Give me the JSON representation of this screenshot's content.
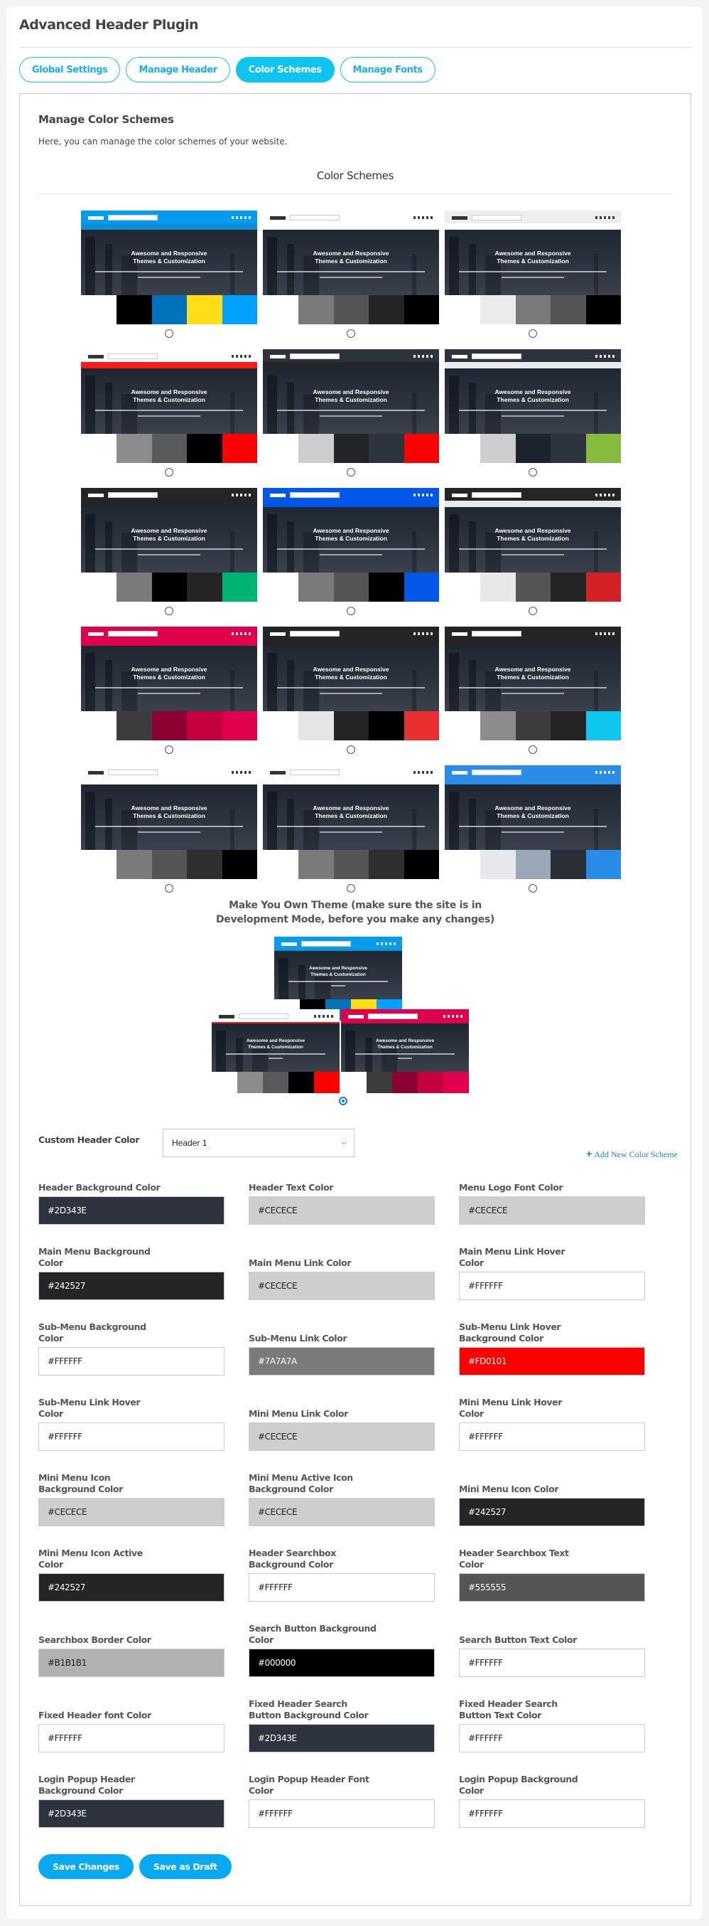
{
  "app": {
    "title": "Advanced Header Plugin"
  },
  "tabs": [
    {
      "label": "Global Settings",
      "active": false
    },
    {
      "label": "Manage Header",
      "active": false
    },
    {
      "label": "Color Schemes",
      "active": true
    },
    {
      "label": "Manage Fonts",
      "active": false
    }
  ],
  "section": {
    "title": "Manage Color Schemes",
    "description": "Here, you can manage the color schemes of your website.",
    "schemes_heading": "Color Schemes"
  },
  "preview_text": {
    "hero_title": "Awesome and Responsive Themes & Customization"
  },
  "schemes": [
    {
      "header": "#049dee",
      "nav": "#0c8ed6",
      "swatches": [
        "#000000",
        "#0072bb",
        "#ffde17",
        "#00a2ff"
      ],
      "selected": false
    },
    {
      "header": "#ffffff",
      "nav": "#ffffff",
      "swatches": [
        "#7a7a7a",
        "#555555",
        "#242424",
        "#000000"
      ],
      "selected": false
    },
    {
      "header": "#eeeeee",
      "nav": "#ffffff",
      "swatches": [
        "#ececec",
        "#7a7a7a",
        "#555555",
        "#000000"
      ],
      "selected": false
    },
    {
      "header": "#ffffff",
      "nav": "#ff0000",
      "swatches": [
        "#8c8c8c",
        "#5a5a5a",
        "#000000",
        "#ff0000"
      ],
      "selected": false
    },
    {
      "header": "#2d343e",
      "nav": "#242527",
      "swatches": [
        "#cecece",
        "#242527",
        "#2d343e",
        "#ff0000"
      ],
      "selected": false
    },
    {
      "header": "#2d343e",
      "nav": "#ffffff",
      "swatches": [
        "#cecece",
        "#1d232d",
        "#2d343e",
        "#86bb3f"
      ],
      "selected": false
    },
    {
      "header": "#242527",
      "nav": "#242527",
      "swatches": [
        "#7a7a7a",
        "#000000",
        "#242424",
        "#00b573"
      ],
      "selected": false
    },
    {
      "header": "#0057e8",
      "nav": "#0057e8",
      "swatches": [
        "#7a7a7a",
        "#555555",
        "#000000",
        "#0057e8"
      ],
      "selected": false
    },
    {
      "header": "#242527",
      "nav": "#ffffff",
      "swatches": [
        "#e8e8e8",
        "#555555",
        "#242424",
        "#d32125"
      ],
      "selected": false
    },
    {
      "header": "#e0004b",
      "nav": "#e0004b",
      "swatches": [
        "#3c3c3c",
        "#8c0032",
        "#c4003f",
        "#e0004b"
      ],
      "selected": false
    },
    {
      "header": "#242527",
      "nav": "#242527",
      "swatches": [
        "#e5e5e5",
        "#242424",
        "#000000",
        "#e83030"
      ],
      "selected": false
    },
    {
      "header": "#242527",
      "nav": "#242527",
      "swatches": [
        "#8c8c8c",
        "#3c3c3c",
        "#242424",
        "#0ec6ef"
      ],
      "selected": false
    },
    {
      "header": "#ffffff",
      "nav": "#ffffff",
      "swatches": [
        "#7a7a7a",
        "#555555",
        "#2f2f2f",
        "#000000"
      ],
      "selected": false
    },
    {
      "header": "#ffffff",
      "nav": "#ffffff",
      "swatches": [
        "#7a7a7a",
        "#555555",
        "#2f2f2f",
        "#000000"
      ],
      "selected": false
    },
    {
      "header": "#2a8be8",
      "nav": "#2a8be8",
      "swatches": [
        "#e5e8ec",
        "#9aa7b6",
        "#2a2f37",
        "#2a8be8"
      ],
      "selected": false
    }
  ],
  "custom_theme": {
    "heading": "Make You Own Theme (make sure the site is in Development Mode, before you make any changes)",
    "previews": [
      {
        "header": "#049dee",
        "nav": "#0c8ed6",
        "swatches": [
          "#000000",
          "#0072bb",
          "#ffde17",
          "#00a2ff"
        ]
      },
      {
        "header": "#ffffff",
        "nav": "#ff0000",
        "swatches": [
          "#8c8c8c",
          "#5a5a5a",
          "#000000",
          "#ff0000"
        ]
      },
      {
        "header": "#e0004b",
        "nav": "#e0004b",
        "swatches": [
          "#3c3c3c",
          "#8c0032",
          "#c4003f",
          "#e0004b"
        ]
      }
    ],
    "selected": true
  },
  "form": {
    "custom_header_label": "Custom Header Color",
    "select_value": "Header 1",
    "add_link": "Add New Color Scheme",
    "fields": [
      {
        "label": "Header Background Color",
        "value": "#2D343E",
        "bg": "#2D343E",
        "fg": "#ffffff"
      },
      {
        "label": "Header Text Color",
        "value": "#CECECE",
        "bg": "#CECECE",
        "fg": "#222222"
      },
      {
        "label": "Menu Logo Font Color",
        "value": "#CECECE",
        "bg": "#CECECE",
        "fg": "#222222"
      },
      {
        "label": "Main Menu Background Color",
        "value": "#242527",
        "bg": "#242527",
        "fg": "#ffffff"
      },
      {
        "label": "Main Menu Link Color",
        "value": "#CECECE",
        "bg": "#CECECE",
        "fg": "#222222"
      },
      {
        "label": "Main Menu Link Hover Color",
        "value": "#FFFFFF",
        "bg": "#FFFFFF",
        "fg": "#222222"
      },
      {
        "label": "Sub-Menu Background Color",
        "value": "#FFFFFF",
        "bg": "#FFFFFF",
        "fg": "#222222"
      },
      {
        "label": "Sub-Menu Link Color",
        "value": "#7A7A7A",
        "bg": "#7A7A7A",
        "fg": "#ffffff"
      },
      {
        "label": "Sub-Menu Link Hover Background Color",
        "value": "#FD0101",
        "bg": "#FD0101",
        "fg": "#ffffff"
      },
      {
        "label": "Sub-Menu Link Hover Color",
        "value": "#FFFFFF",
        "bg": "#FFFFFF",
        "fg": "#222222"
      },
      {
        "label": "Mini Menu Link Color",
        "value": "#CECECE",
        "bg": "#CECECE",
        "fg": "#222222"
      },
      {
        "label": "Mini Menu Link Hover Color",
        "value": "#FFFFFF",
        "bg": "#FFFFFF",
        "fg": "#222222"
      },
      {
        "label": "Mini Menu Icon Background Color",
        "value": "#CECECE",
        "bg": "#CECECE",
        "fg": "#222222"
      },
      {
        "label": "Mini Menu Active Icon Background Color",
        "value": "#CECECE",
        "bg": "#CECECE",
        "fg": "#222222"
      },
      {
        "label": "Mini Menu Icon Color",
        "value": "#242527",
        "bg": "#242527",
        "fg": "#ffffff"
      },
      {
        "label": "Mini Menu Icon Active Color",
        "value": "#242527",
        "bg": "#242527",
        "fg": "#ffffff"
      },
      {
        "label": "Header Searchbox Background Color",
        "value": "#FFFFFF",
        "bg": "#FFFFFF",
        "fg": "#222222"
      },
      {
        "label": "Header Searchbox Text Color",
        "value": "#555555",
        "bg": "#555555",
        "fg": "#ffffff"
      },
      {
        "label": "Searchbox Border Color",
        "value": "#B1B1B1",
        "bg": "#B1B1B1",
        "fg": "#222222"
      },
      {
        "label": "Search Button Background Color",
        "value": "#000000",
        "bg": "#000000",
        "fg": "#ffffff"
      },
      {
        "label": "Search Button Text Color",
        "value": "#FFFFFF",
        "bg": "#FFFFFF",
        "fg": "#222222"
      },
      {
        "label": "Fixed Header font Color",
        "value": "#FFFFFF",
        "bg": "#FFFFFF",
        "fg": "#222222"
      },
      {
        "label": "Fixed Header Search Button Background Color",
        "value": "#2D343E",
        "bg": "#2D343E",
        "fg": "#ffffff"
      },
      {
        "label": "Fixed Header Search Button Text Color",
        "value": "#FFFFFF",
        "bg": "#FFFFFF",
        "fg": "#222222"
      },
      {
        "label": "Login Popup Header Background Color",
        "value": "#2D343E",
        "bg": "#2D343E",
        "fg": "#ffffff"
      },
      {
        "label": "Login Popup Header Font Color",
        "value": "#FFFFFF",
        "bg": "#FFFFFF",
        "fg": "#222222"
      },
      {
        "label": "Login Popup Background Color",
        "value": "#FFFFFF",
        "bg": "#FFFFFF",
        "fg": "#222222"
      }
    ]
  },
  "actions": {
    "save_label": "Save Changes",
    "draft_label": "Save as Draft"
  },
  "colors": {
    "accent": "#0ec5ef",
    "button": "#07aaf2",
    "link": "#1e88c7"
  }
}
